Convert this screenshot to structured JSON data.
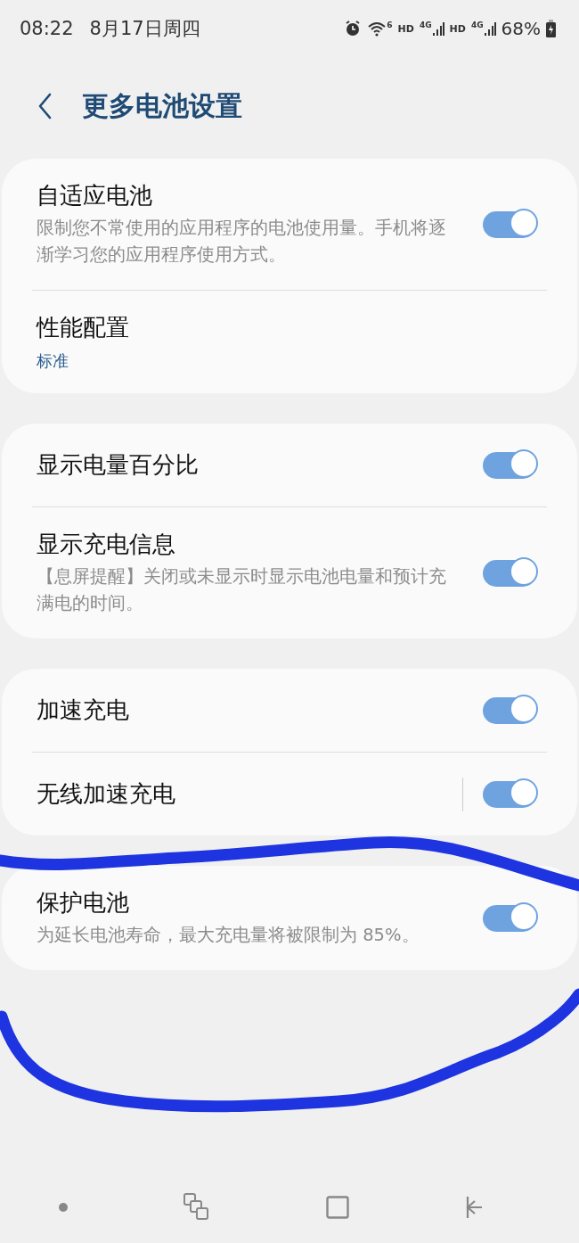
{
  "status_bar": {
    "time": "08:22",
    "date": "8月17日周四",
    "indicators": [
      {
        "kind": "alarm"
      },
      {
        "kind": "wifi",
        "label": "6"
      },
      {
        "kind": "hd",
        "label": "HD"
      },
      {
        "kind": "signal",
        "label": "4G"
      },
      {
        "kind": "hd",
        "label": "HD"
      },
      {
        "kind": "signal",
        "label": "4G"
      }
    ],
    "battery": "68%"
  },
  "header": {
    "title": "更多电池设置"
  },
  "groups": [
    {
      "rows": [
        {
          "kind": "toggle",
          "title": "自适应电池",
          "subtitle": "限制您不常使用的应用程序的电池使用量。手机将逐渐学习您的应用程序使用方式。",
          "on": true
        },
        {
          "kind": "value",
          "title": "性能配置",
          "value": "标准"
        }
      ]
    },
    {
      "rows": [
        {
          "kind": "toggle",
          "title": "显示电量百分比",
          "on": true
        },
        {
          "kind": "toggle",
          "title": "显示充电信息",
          "subtitle": "【息屏提醒】关闭或未显示时显示电池电量和预计充满电的时间。",
          "on": true
        }
      ]
    },
    {
      "rows": [
        {
          "kind": "toggle",
          "title": "加速充电",
          "on": true
        },
        {
          "kind": "toggle",
          "title": "无线加速充电",
          "on": true,
          "divided": true
        }
      ]
    },
    {
      "rows": [
        {
          "kind": "toggle",
          "title": "保护电池",
          "subtitle": "为延长电池寿命，最大充电量将被限制为 85%。",
          "on": true
        }
      ]
    }
  ],
  "pen_strokes": [
    {
      "kind": "pen"
    },
    {
      "kind": "pen"
    }
  ],
  "nav_bar": [
    {
      "kind": "dot"
    },
    {
      "kind": "recents"
    },
    {
      "kind": "home"
    },
    {
      "kind": "back"
    }
  ]
}
